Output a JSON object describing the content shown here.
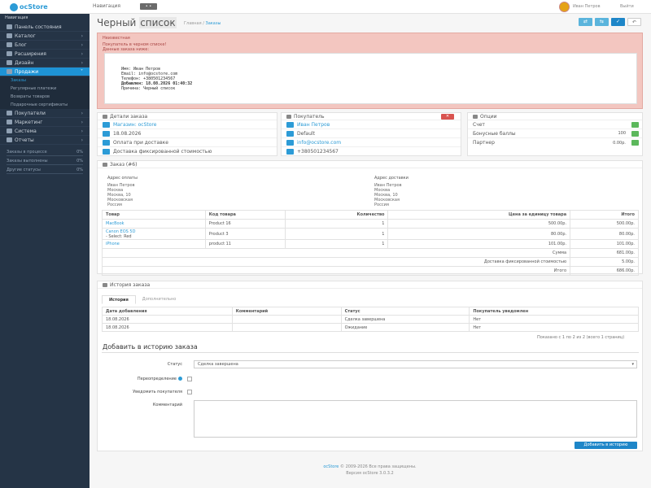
{
  "topbar": {
    "logo": "ocStore",
    "menu_label": "Навигация",
    "button_label": "• •",
    "user": "Иван Петров",
    "logout": "Выйти"
  },
  "sidebar": {
    "heading": "Навигация",
    "items": [
      {
        "label": "Панель состояния"
      },
      {
        "label": "Каталог"
      },
      {
        "label": "Блог"
      },
      {
        "label": "Расширения"
      },
      {
        "label": "Дизайн"
      },
      {
        "label": "Продажи"
      }
    ],
    "subitems": [
      "Заказы",
      "Регулярные платежи",
      "Возвраты товаров",
      "Подарочные сертификаты"
    ],
    "items2": [
      {
        "label": "Покупатели"
      },
      {
        "label": "Маркетинг"
      },
      {
        "label": "Система"
      },
      {
        "label": "Отчеты"
      }
    ],
    "stats": [
      {
        "label": "Заказы в процессе",
        "value": "0%",
        "fill": 0.0
      },
      {
        "label": "Заказы выполнены",
        "value": "0%",
        "fill": 0.0
      },
      {
        "label": "Другие статусы",
        "value": "0%",
        "fill": 0.0
      }
    ]
  },
  "header": {
    "title_a": "Черный",
    "title_b": "список",
    "breadcrumb_home": "Главная",
    "breadcrumb_sep": " / ",
    "breadcrumb_current": "Заказы"
  },
  "actions": [
    "⇄",
    "⇆",
    "✓",
    "↶"
  ],
  "alert": {
    "title": "Неизвестная",
    "line1": "Покупатель в черном списке!",
    "line2": "Данные заказа ниже:",
    "pre": [
      "Имя: Иван Петров",
      "Email: info@ocstore.com",
      "Телефон: +380501234567",
      "Добавлен: 18.08.2026 01:40:32",
      "Причина: Черный список"
    ]
  },
  "order_panel": {
    "title": "Детали заказа",
    "rows": [
      "Магазин: ocStore",
      "18.08.2026",
      "Оплата при доставке",
      "Доставка фиксированной стоимостью"
    ]
  },
  "customer_panel": {
    "title": "Покупатель",
    "delete": "✕",
    "rows": [
      "Иван Петров",
      "Default",
      "info@ocstore.com",
      "+380501234567"
    ]
  },
  "options_panel": {
    "title": "Опции",
    "rows": [
      {
        "label": "Счет",
        "value": ""
      },
      {
        "label": "Бонусные баллы",
        "value": "100"
      },
      {
        "label": "Партнер",
        "value": "0.00р."
      }
    ]
  },
  "order_info": {
    "title": "Заказ (#6)",
    "payment_h": "Адрес оплаты",
    "shipping_h": "Адрес доставки",
    "payment_lines": [
      "Иван Петров",
      "Москва",
      "Москва, 10",
      "Московская",
      "Россия"
    ],
    "shipping_lines": [
      "Иван Петров",
      "Москва",
      "Москва, 10",
      "Московская",
      "Россия"
    ]
  },
  "products": {
    "headers": [
      "Товар",
      "Код товара",
      "Количество",
      "Цена за единицу товара",
      "Итого"
    ],
    "rows": [
      {
        "name": "MacBook",
        "sub": "",
        "model": "Product 16",
        "qty": "1",
        "price": "500.00р.",
        "total": "500.00р."
      },
      {
        "name": "Canon EOS 5D",
        "sub": "- Select: Red",
        "model": "Product 3",
        "qty": "1",
        "price": "80.00р.",
        "total": "80.00р."
      },
      {
        "name": "iPhone",
        "sub": "",
        "model": "product 11",
        "qty": "1",
        "price": "101.00р.",
        "total": "101.00р."
      }
    ],
    "totals": [
      {
        "label": "Сумма",
        "value": "681.00р."
      },
      {
        "label": "Доставка фиксированной стоимостью",
        "value": "5.00р."
      },
      {
        "label": "Итого",
        "value": "686.00р."
      }
    ]
  },
  "history": {
    "title": "История заказа",
    "tab_history": "История",
    "tab_extra": "Дополнительно",
    "headers": [
      "Дата добавления",
      "Комментарий",
      "Статус",
      "Покупатель уведомлен"
    ],
    "rows": [
      [
        "18.08.2026",
        "",
        "Сделка завершена",
        "Нет"
      ],
      [
        "18.08.2026",
        "",
        "Ожидание",
        "Нет"
      ]
    ],
    "pager": "Показано с 1 по 2 из 2 (всего 1 страниц)"
  },
  "form": {
    "title": "Добавить в историю заказа",
    "status_label": "Статус",
    "status_value": "Сделка завершена",
    "override_label": "Переопределение",
    "notify_label": "Уведомить покупателя",
    "comment_label": "Комментарий",
    "button": "Добавить в историю"
  },
  "footer": {
    "brand": "ocStore",
    "line1": " © 2009-2026 Все права защищены.",
    "line2": "Версия ocStore 3.0.3.2"
  },
  "colors": {
    "accent": "#2c9bd6",
    "sidebar": "#253446",
    "alert": "#f3c6c0",
    "danger": "#d9534f",
    "success": "#5cb85c"
  }
}
